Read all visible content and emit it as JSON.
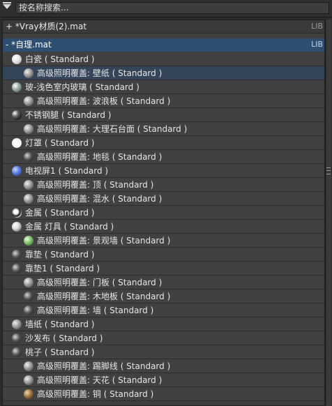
{
  "search": {
    "placeholder": "按名称搜索..."
  },
  "libraries": [
    {
      "toggle": "+",
      "name": "*Vray材质(2).mat",
      "tag": "LIB"
    },
    {
      "toggle": "-",
      "name": "*自理.mat",
      "tag": "LIB"
    }
  ],
  "materials": [
    {
      "level": 0,
      "name": "白瓷",
      "type": "( Standard )",
      "icon": "white-sphere"
    },
    {
      "level": 1,
      "name": "高级照明覆盖: 壁纸",
      "type": "( Standard )",
      "icon": "gray-sphere",
      "selected": true
    },
    {
      "level": 0,
      "name": "玻-浅色室内玻璃",
      "type": "( Standard )",
      "icon": "glass-sphere"
    },
    {
      "level": 1,
      "name": "高级照明覆盖: 波浪板",
      "type": "( Standard )",
      "icon": "gray-sphere"
    },
    {
      "level": 0,
      "name": "不锈钢腿",
      "type": "( Standard )",
      "icon": "steel-sphere"
    },
    {
      "level": 1,
      "name": "高级照明覆盖: 大理石台面",
      "type": "( Standard )",
      "icon": "gray-sphere"
    },
    {
      "level": 0,
      "name": "灯罩",
      "type": "( Standard )",
      "icon": "lamp-sphere"
    },
    {
      "level": 1,
      "name": "高级照明覆盖: 地毯",
      "type": "( Standard )",
      "icon": "dark-sphere"
    },
    {
      "level": 0,
      "name": "电视屏1",
      "type": "( Standard )",
      "icon": "blue-sphere"
    },
    {
      "level": 1,
      "name": "高级照明覆盖: 顶",
      "type": "( Standard )",
      "icon": "gray-sphere"
    },
    {
      "level": 1,
      "name": "高级照明覆盖: 混水",
      "type": "( Standard )",
      "icon": "gray-sphere"
    },
    {
      "level": 0,
      "name": "金属",
      "type": "( Standard )",
      "icon": "metal-sphere"
    },
    {
      "level": 0,
      "name": "金属 灯具",
      "type": "( Standard )",
      "icon": "light-sphere"
    },
    {
      "level": 1,
      "name": "高级照明覆盖: 景观墙",
      "type": "( Standard )",
      "icon": "green-sphere"
    },
    {
      "level": 0,
      "name": "靠垫",
      "type": "( Standard )",
      "icon": "dark-sphere"
    },
    {
      "level": 0,
      "name": "靠垫1",
      "type": "( Standard )",
      "icon": "dark-sphere"
    },
    {
      "level": 1,
      "name": "高级照明覆盖: 门板",
      "type": "( Standard )",
      "icon": "gray-sphere"
    },
    {
      "level": 1,
      "name": "高级照明覆盖: 木地板",
      "type": "( Standard )",
      "icon": "dark-sphere"
    },
    {
      "level": 1,
      "name": "高级照明覆盖: 墙",
      "type": "( Standard )",
      "icon": "dark-sphere"
    },
    {
      "level": 0,
      "name": "墙纸",
      "type": "( Standard )",
      "icon": "gray-sphere"
    },
    {
      "level": 0,
      "name": "沙发布",
      "type": "( Standard )",
      "icon": "dark-sphere"
    },
    {
      "level": 0,
      "name": "桃子",
      "type": "( Standard )",
      "icon": "dark-sphere"
    },
    {
      "level": 1,
      "name": "高级照明覆盖: 踢脚线",
      "type": "( Standard )",
      "icon": "gray-sphere"
    },
    {
      "level": 1,
      "name": "高级照明覆盖: 天花",
      "type": "( Standard )",
      "icon": "gray-sphere"
    },
    {
      "level": 1,
      "name": "高级照明覆盖: 铜",
      "type": "( Standard )",
      "icon": "copper-sphere"
    }
  ]
}
